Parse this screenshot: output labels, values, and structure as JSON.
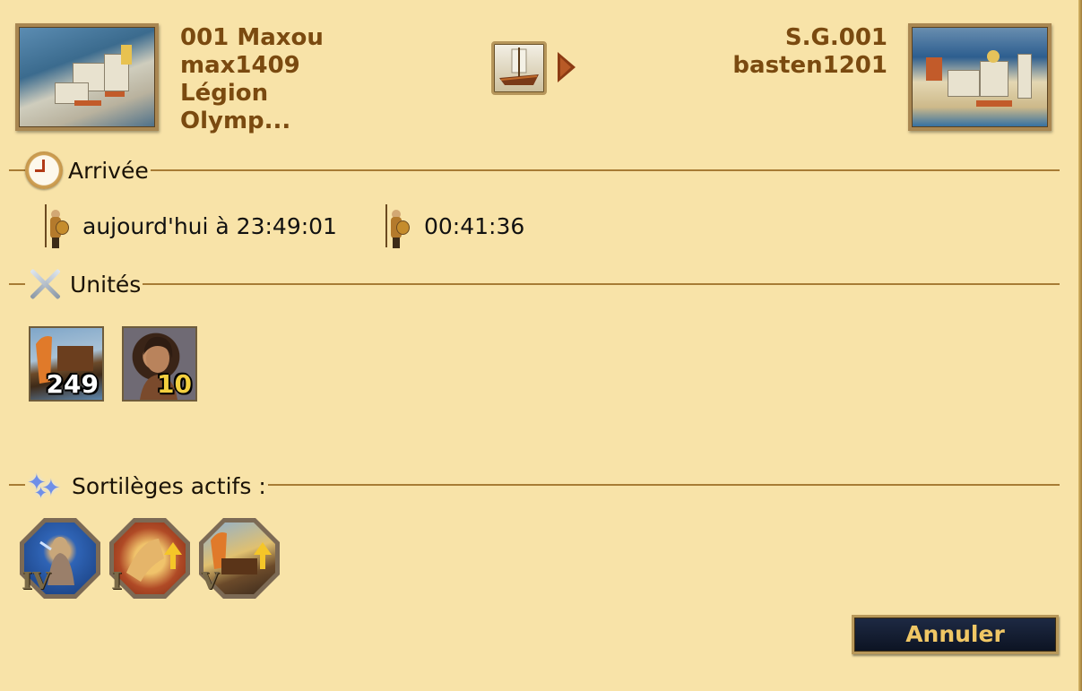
{
  "source": {
    "city_name": "001 Maxou",
    "player": "max1409",
    "alliance_line1": "Légion",
    "alliance_line2": "Olymp..."
  },
  "target": {
    "city_name": "S.G.001",
    "player": "basten1201"
  },
  "movement": {
    "transport_icon": "transport-ship-icon",
    "direction_icon": "arrow-right-icon"
  },
  "arrival": {
    "title": "Arrivée",
    "arrival_time": "aujourd'hui à 23:49:01",
    "duration": "00:41:36"
  },
  "units": {
    "title": "Unités",
    "items": [
      {
        "icon": "transport-boat-icon",
        "count": "249"
      },
      {
        "icon": "hero-icon",
        "count": "10"
      }
    ]
  },
  "spells": {
    "title": "Sortilèges actifs :",
    "items": [
      {
        "icon": "zeus-spell-icon",
        "level": "IV"
      },
      {
        "icon": "attack-boost-spell-icon",
        "level": "I"
      },
      {
        "icon": "ship-speed-boost-spell-icon",
        "level": "V"
      }
    ]
  },
  "actions": {
    "cancel_label": "Annuler"
  },
  "colors": {
    "background": "#f8e3a8",
    "city_text": "#7a4a10",
    "button_text": "#f0c765",
    "button_bg": "#0c1322"
  }
}
